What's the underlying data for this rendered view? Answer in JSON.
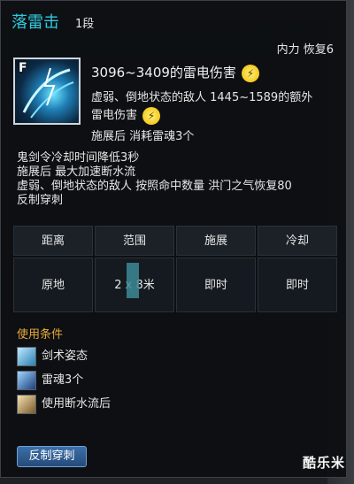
{
  "header": {
    "title": "落雷击",
    "rank": "1段",
    "right_info": "内力 恢复6"
  },
  "skill": {
    "icon_key": "F",
    "damage_main": "3096~3409的雷电伤害",
    "extra_line1": "虚弱、倒地状态的敌人 1445~1589的额外",
    "extra_line2": "雷电伤害",
    "after_cast": "施展后 消耗雷魂3个"
  },
  "effects": [
    "鬼剑令冷却时间降低3秒",
    "施展后 最大加速断水流",
    "虚弱、倒地状态的敌人 按照命中数量 洪门之气恢复80",
    "反制穿刺"
  ],
  "table": {
    "headers": [
      "距离",
      "范围",
      "施展",
      "冷却"
    ],
    "values": [
      "原地",
      "2 x 8米",
      "即时",
      "即时"
    ]
  },
  "conditions": {
    "title": "使用条件",
    "items": [
      {
        "label": "剑术姿态",
        "icon": "sword-stance-icon"
      },
      {
        "label": "雷魂3个",
        "icon": "thunder-soul-icon"
      },
      {
        "label": "使用断水流后",
        "icon": "water-cut-icon"
      }
    ]
  },
  "badge": "反制穿刺",
  "watermark": "酷乐米",
  "colors": {
    "title": "#2ecbe0",
    "condition_title": "#e6a93a",
    "button": "#2f5f94"
  }
}
